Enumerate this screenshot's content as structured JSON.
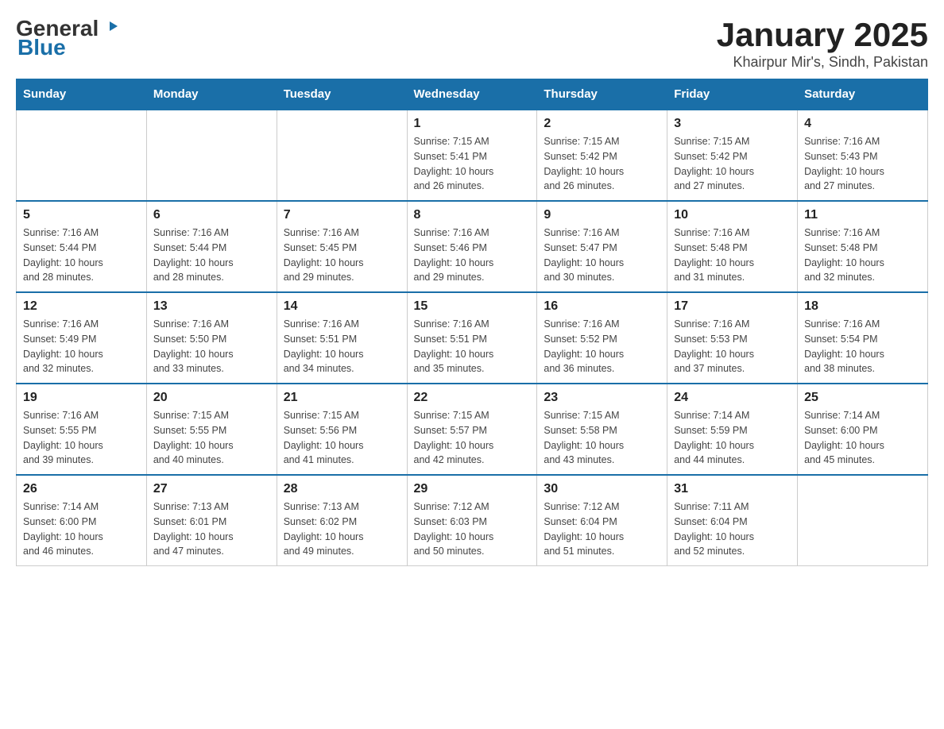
{
  "logo": {
    "text_general": "General",
    "text_blue": "Blue"
  },
  "header": {
    "title": "January 2025",
    "subtitle": "Khairpur Mir's, Sindh, Pakistan"
  },
  "days_of_week": [
    "Sunday",
    "Monday",
    "Tuesday",
    "Wednesday",
    "Thursday",
    "Friday",
    "Saturday"
  ],
  "weeks": [
    [
      {
        "day": "",
        "info": ""
      },
      {
        "day": "",
        "info": ""
      },
      {
        "day": "",
        "info": ""
      },
      {
        "day": "1",
        "info": "Sunrise: 7:15 AM\nSunset: 5:41 PM\nDaylight: 10 hours\nand 26 minutes."
      },
      {
        "day": "2",
        "info": "Sunrise: 7:15 AM\nSunset: 5:42 PM\nDaylight: 10 hours\nand 26 minutes."
      },
      {
        "day": "3",
        "info": "Sunrise: 7:15 AM\nSunset: 5:42 PM\nDaylight: 10 hours\nand 27 minutes."
      },
      {
        "day": "4",
        "info": "Sunrise: 7:16 AM\nSunset: 5:43 PM\nDaylight: 10 hours\nand 27 minutes."
      }
    ],
    [
      {
        "day": "5",
        "info": "Sunrise: 7:16 AM\nSunset: 5:44 PM\nDaylight: 10 hours\nand 28 minutes."
      },
      {
        "day": "6",
        "info": "Sunrise: 7:16 AM\nSunset: 5:44 PM\nDaylight: 10 hours\nand 28 minutes."
      },
      {
        "day": "7",
        "info": "Sunrise: 7:16 AM\nSunset: 5:45 PM\nDaylight: 10 hours\nand 29 minutes."
      },
      {
        "day": "8",
        "info": "Sunrise: 7:16 AM\nSunset: 5:46 PM\nDaylight: 10 hours\nand 29 minutes."
      },
      {
        "day": "9",
        "info": "Sunrise: 7:16 AM\nSunset: 5:47 PM\nDaylight: 10 hours\nand 30 minutes."
      },
      {
        "day": "10",
        "info": "Sunrise: 7:16 AM\nSunset: 5:48 PM\nDaylight: 10 hours\nand 31 minutes."
      },
      {
        "day": "11",
        "info": "Sunrise: 7:16 AM\nSunset: 5:48 PM\nDaylight: 10 hours\nand 32 minutes."
      }
    ],
    [
      {
        "day": "12",
        "info": "Sunrise: 7:16 AM\nSunset: 5:49 PM\nDaylight: 10 hours\nand 32 minutes."
      },
      {
        "day": "13",
        "info": "Sunrise: 7:16 AM\nSunset: 5:50 PM\nDaylight: 10 hours\nand 33 minutes."
      },
      {
        "day": "14",
        "info": "Sunrise: 7:16 AM\nSunset: 5:51 PM\nDaylight: 10 hours\nand 34 minutes."
      },
      {
        "day": "15",
        "info": "Sunrise: 7:16 AM\nSunset: 5:51 PM\nDaylight: 10 hours\nand 35 minutes."
      },
      {
        "day": "16",
        "info": "Sunrise: 7:16 AM\nSunset: 5:52 PM\nDaylight: 10 hours\nand 36 minutes."
      },
      {
        "day": "17",
        "info": "Sunrise: 7:16 AM\nSunset: 5:53 PM\nDaylight: 10 hours\nand 37 minutes."
      },
      {
        "day": "18",
        "info": "Sunrise: 7:16 AM\nSunset: 5:54 PM\nDaylight: 10 hours\nand 38 minutes."
      }
    ],
    [
      {
        "day": "19",
        "info": "Sunrise: 7:16 AM\nSunset: 5:55 PM\nDaylight: 10 hours\nand 39 minutes."
      },
      {
        "day": "20",
        "info": "Sunrise: 7:15 AM\nSunset: 5:55 PM\nDaylight: 10 hours\nand 40 minutes."
      },
      {
        "day": "21",
        "info": "Sunrise: 7:15 AM\nSunset: 5:56 PM\nDaylight: 10 hours\nand 41 minutes."
      },
      {
        "day": "22",
        "info": "Sunrise: 7:15 AM\nSunset: 5:57 PM\nDaylight: 10 hours\nand 42 minutes."
      },
      {
        "day": "23",
        "info": "Sunrise: 7:15 AM\nSunset: 5:58 PM\nDaylight: 10 hours\nand 43 minutes."
      },
      {
        "day": "24",
        "info": "Sunrise: 7:14 AM\nSunset: 5:59 PM\nDaylight: 10 hours\nand 44 minutes."
      },
      {
        "day": "25",
        "info": "Sunrise: 7:14 AM\nSunset: 6:00 PM\nDaylight: 10 hours\nand 45 minutes."
      }
    ],
    [
      {
        "day": "26",
        "info": "Sunrise: 7:14 AM\nSunset: 6:00 PM\nDaylight: 10 hours\nand 46 minutes."
      },
      {
        "day": "27",
        "info": "Sunrise: 7:13 AM\nSunset: 6:01 PM\nDaylight: 10 hours\nand 47 minutes."
      },
      {
        "day": "28",
        "info": "Sunrise: 7:13 AM\nSunset: 6:02 PM\nDaylight: 10 hours\nand 49 minutes."
      },
      {
        "day": "29",
        "info": "Sunrise: 7:12 AM\nSunset: 6:03 PM\nDaylight: 10 hours\nand 50 minutes."
      },
      {
        "day": "30",
        "info": "Sunrise: 7:12 AM\nSunset: 6:04 PM\nDaylight: 10 hours\nand 51 minutes."
      },
      {
        "day": "31",
        "info": "Sunrise: 7:11 AM\nSunset: 6:04 PM\nDaylight: 10 hours\nand 52 minutes."
      },
      {
        "day": "",
        "info": ""
      }
    ]
  ]
}
